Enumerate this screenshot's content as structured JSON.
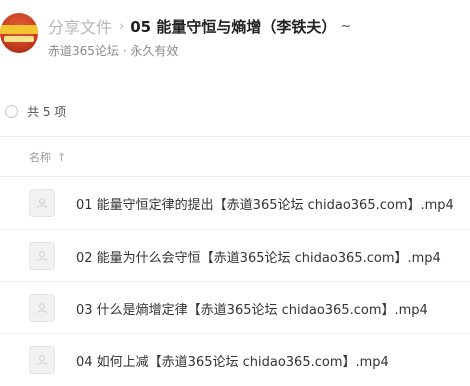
{
  "header": {
    "breadcrumb_root": "分享文件",
    "breadcrumb_separator": "›",
    "folder_title": "05 能量守恒与熵增（李铁夫）",
    "folder_caret": "~",
    "sharer": "赤道365论坛 · 永久有效",
    "avatar_icon": "forum-logo-icon"
  },
  "list": {
    "count_text": "共 5 项",
    "column_name": "名称",
    "sort_indicator": "↑",
    "files": [
      {
        "name": "01 能量守恒定律的提出【赤道365论坛 chidao365.com】.mp4",
        "icon": "video-file-icon"
      },
      {
        "name": "02 能量为什么会守恒【赤道365论坛 chidao365.com】.mp4",
        "icon": "video-file-icon"
      },
      {
        "name": "03 什么是熵增定律【赤道365论坛 chidao365.com】.mp4",
        "icon": "video-file-icon"
      },
      {
        "name": "04 如何上减【赤道365论坛 chidao365.com】.mp4",
        "icon": "video-file-icon"
      }
    ]
  }
}
